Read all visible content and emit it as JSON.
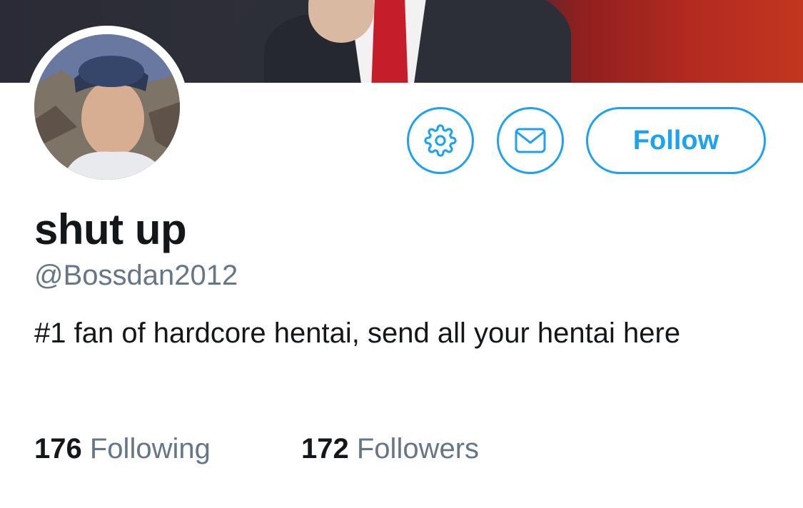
{
  "profile": {
    "display_name": "shut up",
    "handle": "@Bossdan2012",
    "bio": "#1 fan of hardcore hentai, send all your hentai here"
  },
  "actions": {
    "settings_icon": "gear-icon",
    "message_icon": "envelope-icon",
    "follow_label": "Follow"
  },
  "stats": {
    "following_count": "176",
    "following_label": "Following",
    "followers_count": "172",
    "followers_label": "Followers"
  },
  "colors": {
    "accent": "#1da1f2",
    "text_primary": "#14171a",
    "text_secondary": "#657786"
  }
}
